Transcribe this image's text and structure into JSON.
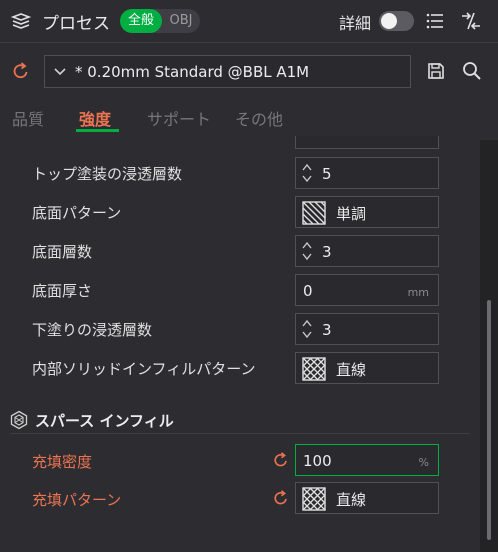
{
  "header": {
    "title": "プロセス",
    "mode_global": "全般",
    "mode_object": "OBJ",
    "detail_label": "詳細"
  },
  "preset": {
    "name": "* 0.20mm Standard @BBL A1M"
  },
  "tabs": [
    {
      "label": "品質"
    },
    {
      "label": "強度"
    },
    {
      "label": "サポート"
    },
    {
      "label": "その他"
    }
  ],
  "settings": {
    "top_infill_layers": {
      "label": "トップ塗装の浸透層数",
      "value": "5"
    },
    "bottom_pattern": {
      "label": "底面パターン",
      "value": "単調"
    },
    "bottom_layers": {
      "label": "底面層数",
      "value": "3"
    },
    "bottom_thickness": {
      "label": "底面厚さ",
      "value": "0",
      "unit": "mm"
    },
    "bottom_shell_layers": {
      "label": "下塗りの浸透層数",
      "value": "3"
    },
    "internal_solid_pattern": {
      "label": "内部ソリッドインフィルパターン",
      "value": "直線"
    }
  },
  "sparse_infill": {
    "title": "スパース インフィル",
    "density": {
      "label": "充填密度",
      "value": "100",
      "unit": "%"
    },
    "pattern": {
      "label": "充填パターン",
      "value": "直線"
    }
  },
  "colors": {
    "accent_green": "#00ae42",
    "modified_orange": "#ec7351",
    "background": "#2d2d31"
  },
  "icons": [
    "layers-icon",
    "list-icon",
    "compare-icon",
    "reset-icon",
    "chevron-down-icon",
    "save-icon",
    "search-icon",
    "spinner-icon",
    "pattern-icon",
    "section-hex-icon"
  ]
}
